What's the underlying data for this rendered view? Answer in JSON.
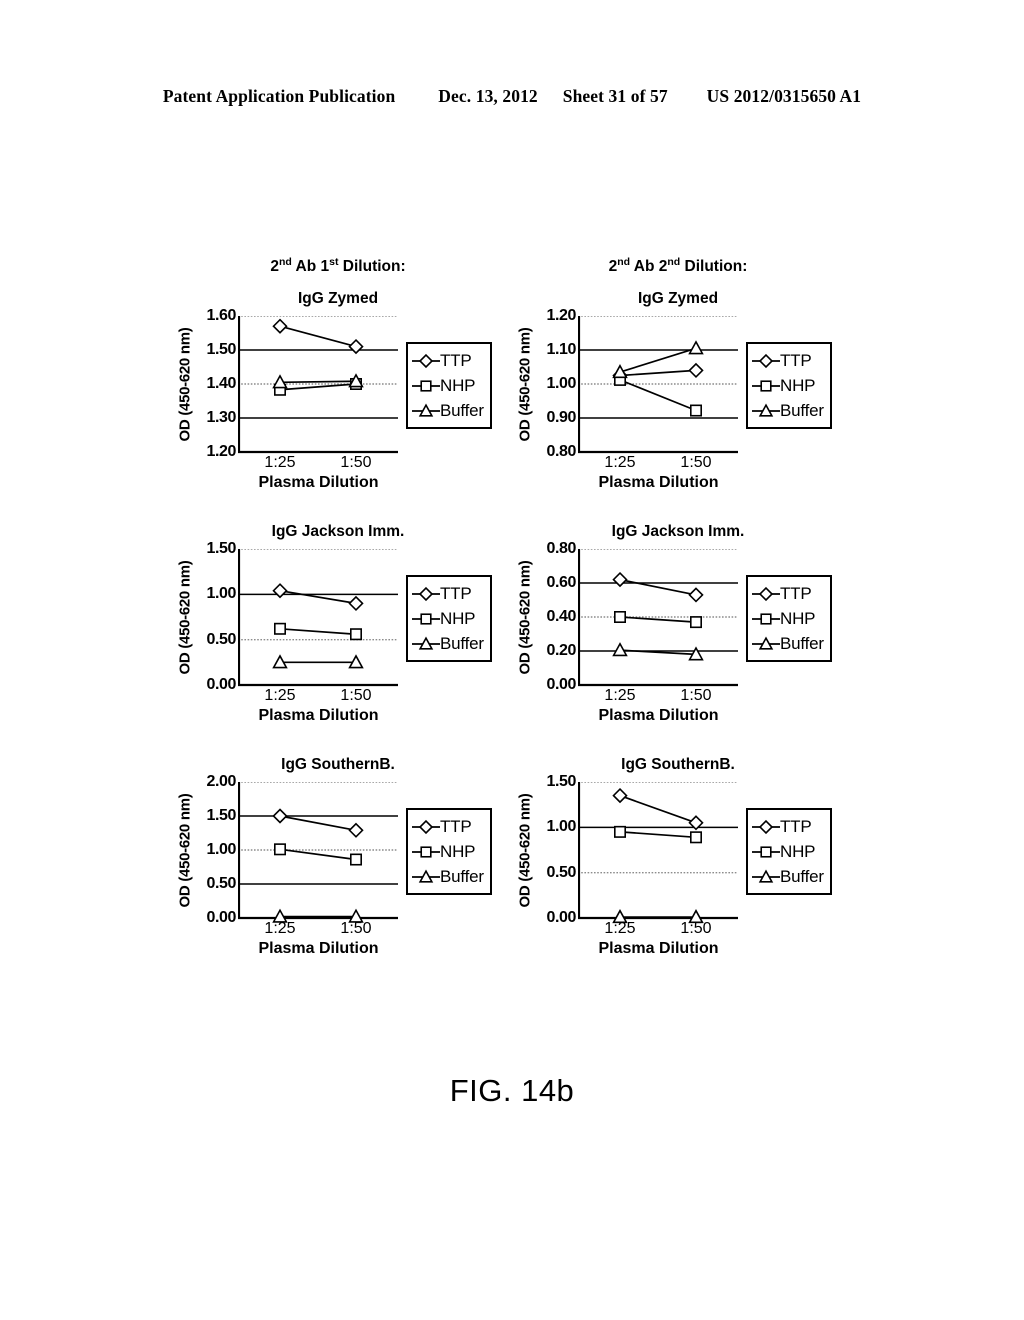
{
  "header": {
    "publication": "Patent Application Publication",
    "date": "Dec. 13, 2012",
    "sheet": "Sheet 31 of 57",
    "number": "US 2012/0315650 A1"
  },
  "figure": {
    "caption": "FIG. 14b"
  },
  "column_headings": [
    {
      "prefix": "2",
      "sup1": "nd",
      "mid": " Ab 1",
      "sup2": "st",
      "suffix": " Dilution:"
    },
    {
      "prefix": "2",
      "sup1": "nd",
      "mid": " Ab 2",
      "sup2": "nd",
      "suffix": " Dilution:"
    }
  ],
  "legend_entries": [
    "TTP",
    "NHP",
    "Buffer"
  ],
  "axis_labels": {
    "y": "OD (450-620 nm)",
    "x": "Plasma Dilution"
  },
  "chart_data": [
    {
      "id": "zymed-1st",
      "type": "line",
      "title": "IgG Zymed",
      "column_heading": "2nd Ab 1st Dilution:",
      "xlabel": "Plasma Dilution",
      "ylabel": "OD (450-620 nm)",
      "categories": [
        "1:25",
        "1:50"
      ],
      "yticks": [
        "1.20",
        "1.30",
        "1.40",
        "1.50",
        "1.60"
      ],
      "ylim": [
        1.2,
        1.6
      ],
      "grid": true,
      "legend_position": "right",
      "series": [
        {
          "name": "TTP",
          "marker": "diamond",
          "values": [
            1.57,
            1.51
          ]
        },
        {
          "name": "NHP",
          "marker": "square",
          "values": [
            1.383,
            1.4
          ]
        },
        {
          "name": "Buffer",
          "marker": "triangle",
          "values": [
            1.405,
            1.408
          ]
        }
      ]
    },
    {
      "id": "zymed-2nd",
      "type": "line",
      "title": "IgG Zymed",
      "column_heading": "2nd Ab 2nd Dilution:",
      "xlabel": "Plasma Dilution",
      "ylabel": "OD (450-620 nm)",
      "categories": [
        "1:25",
        "1:50"
      ],
      "yticks": [
        "0.80",
        "0.90",
        "1.00",
        "1.10",
        "1.20"
      ],
      "ylim": [
        0.8,
        1.2
      ],
      "grid": true,
      "legend_position": "right",
      "series": [
        {
          "name": "TTP",
          "marker": "diamond",
          "values": [
            1.025,
            1.04
          ]
        },
        {
          "name": "NHP",
          "marker": "square",
          "values": [
            1.012,
            0.922
          ]
        },
        {
          "name": "Buffer",
          "marker": "triangle",
          "values": [
            1.035,
            1.105
          ]
        }
      ]
    },
    {
      "id": "jackson-1st",
      "type": "line",
      "title": "IgG Jackson Imm.",
      "column_heading": "2nd Ab 1st Dilution:",
      "xlabel": "Plasma Dilution",
      "ylabel": "OD (450-620 nm)",
      "categories": [
        "1:25",
        "1:50"
      ],
      "yticks": [
        "0.00",
        "0.50",
        "1.00",
        "1.50"
      ],
      "ylim": [
        0.0,
        1.5
      ],
      "grid": true,
      "legend_position": "right",
      "series": [
        {
          "name": "TTP",
          "marker": "diamond",
          "values": [
            1.04,
            0.9
          ]
        },
        {
          "name": "NHP",
          "marker": "square",
          "values": [
            0.62,
            0.56
          ]
        },
        {
          "name": "Buffer",
          "marker": "triangle",
          "values": [
            0.25,
            0.25
          ]
        }
      ]
    },
    {
      "id": "jackson-2nd",
      "type": "line",
      "title": "IgG Jackson Imm.",
      "column_heading": "2nd Ab 2nd Dilution:",
      "xlabel": "Plasma Dilution",
      "ylabel": "OD (450-620 nm)",
      "categories": [
        "1:25",
        "1:50"
      ],
      "yticks": [
        "0.00",
        "0.20",
        "0.40",
        "0.60",
        "0.80"
      ],
      "ylim": [
        0.0,
        0.8
      ],
      "grid": true,
      "legend_position": "right",
      "series": [
        {
          "name": "TTP",
          "marker": "diamond",
          "values": [
            0.62,
            0.53
          ]
        },
        {
          "name": "NHP",
          "marker": "square",
          "values": [
            0.4,
            0.37
          ]
        },
        {
          "name": "Buffer",
          "marker": "triangle",
          "values": [
            0.205,
            0.18
          ]
        }
      ]
    },
    {
      "id": "southern-1st",
      "type": "line",
      "title": "IgG SouthernB.",
      "column_heading": "2nd Ab 1st Dilution:",
      "xlabel": "Plasma Dilution",
      "ylabel": "OD (450-620 nm)",
      "categories": [
        "1:25",
        "1:50"
      ],
      "yticks": [
        "0.00",
        "0.50",
        "1.00",
        "1.50",
        "2.00"
      ],
      "ylim": [
        0.0,
        2.0
      ],
      "grid": true,
      "legend_position": "right",
      "series": [
        {
          "name": "TTP",
          "marker": "diamond",
          "values": [
            1.5,
            1.29
          ]
        },
        {
          "name": "NHP",
          "marker": "square",
          "values": [
            1.01,
            0.86
          ]
        },
        {
          "name": "Buffer",
          "marker": "triangle",
          "values": [
            0.02,
            0.02
          ]
        }
      ]
    },
    {
      "id": "southern-2nd",
      "type": "line",
      "title": "IgG SouthernB.",
      "column_heading": "2nd Ab 2nd Dilution:",
      "xlabel": "Plasma Dilution",
      "ylabel": "OD (450-620 nm)",
      "categories": [
        "1:25",
        "1:50"
      ],
      "yticks": [
        "0.00",
        "0.50",
        "1.00",
        "1.50"
      ],
      "ylim": [
        0.0,
        1.5
      ],
      "grid": true,
      "legend_position": "right",
      "series": [
        {
          "name": "TTP",
          "marker": "diamond",
          "values": [
            1.35,
            1.05
          ]
        },
        {
          "name": "NHP",
          "marker": "square",
          "values": [
            0.95,
            0.89
          ]
        },
        {
          "name": "Buffer",
          "marker": "triangle",
          "values": [
            0.01,
            0.01
          ]
        }
      ]
    }
  ]
}
